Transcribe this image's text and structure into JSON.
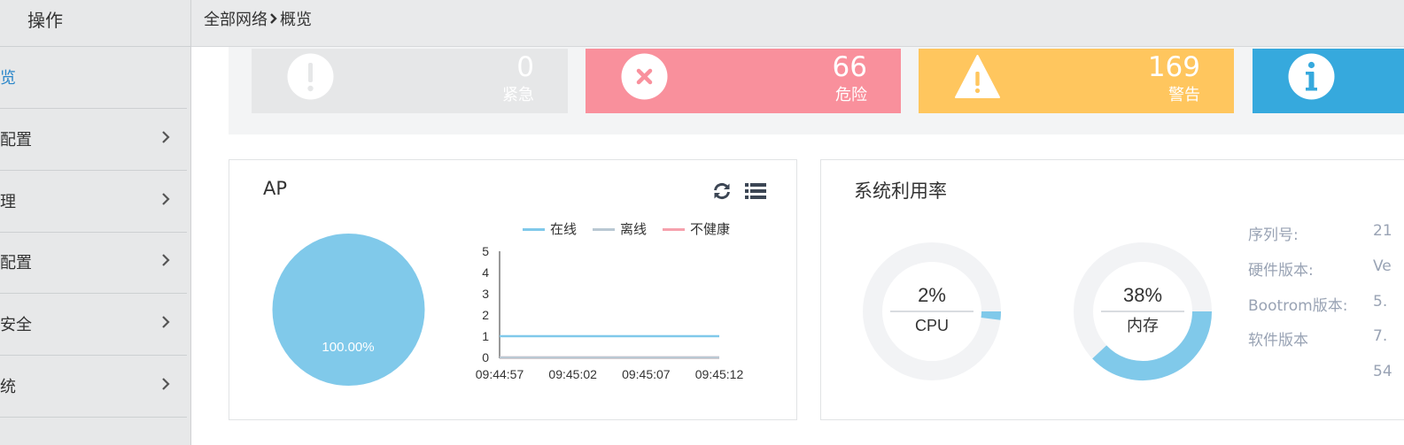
{
  "sidebar": {
    "header": "操作",
    "items": [
      {
        "label": "览",
        "has_chevron": false
      },
      {
        "label": "配置",
        "has_chevron": true
      },
      {
        "label": "理",
        "has_chevron": true
      },
      {
        "label": "配置",
        "has_chevron": true
      },
      {
        "label": "安全",
        "has_chevron": true
      },
      {
        "label": "统",
        "has_chevron": true
      }
    ]
  },
  "breadcrumb": {
    "parent": "全部网络",
    "current": "概览"
  },
  "alarms": [
    {
      "count": "0",
      "label": "紧急",
      "color": "#e6e7e8",
      "icon": "exclamation-circle-icon"
    },
    {
      "count": "66",
      "label": "危险",
      "color": "#f9909c",
      "icon": "x-circle-icon"
    },
    {
      "count": "169",
      "label": "警告",
      "color": "#ffc65e",
      "icon": "warning-triangle-icon"
    },
    {
      "count": "",
      "label": "",
      "color": "#36a9dd",
      "icon": "info-circle-icon"
    }
  ],
  "ap_panel": {
    "title": "AP",
    "refresh_icon": "refresh-icon",
    "list_icon": "list-icon",
    "pie": {
      "label": "100.00%",
      "color": "#80c9ea"
    },
    "legend": [
      {
        "name": "在线",
        "color": "#80c9ea"
      },
      {
        "name": "离线",
        "color": "#b9c8d3"
      },
      {
        "name": "不健康",
        "color": "#f6a1ad"
      }
    ]
  },
  "system_panel": {
    "title": "系统利用率",
    "gauges": [
      {
        "value": "2%",
        "name": "CPU",
        "percent": 2
      },
      {
        "value": "38%",
        "name": "内存",
        "percent": 38
      }
    ],
    "info": [
      {
        "label": "序列号:",
        "value": "21"
      },
      {
        "label": "硬件版本:",
        "value": "Ve"
      },
      {
        "label": "Bootrom版本:",
        "value": "5."
      },
      {
        "label": "软件版本",
        "value": "7."
      },
      {
        "label": "",
        "value": "54"
      }
    ]
  },
  "chart_data": [
    {
      "type": "pie",
      "categories": [
        "在线"
      ],
      "values": [
        100
      ],
      "labels": [
        "100.00%"
      ]
    },
    {
      "type": "line",
      "x": [
        "09:44:57",
        "09:45:02",
        "09:45:07",
        "09:45:12"
      ],
      "series": [
        {
          "name": "在线",
          "values": [
            1,
            1,
            1,
            1
          ]
        },
        {
          "name": "离线",
          "values": [
            0,
            0,
            0,
            0
          ]
        },
        {
          "name": "不健康",
          "values": [
            0,
            0,
            0,
            0
          ]
        }
      ],
      "yticks": [
        "0",
        "1",
        "2",
        "3",
        "4",
        "5"
      ],
      "ylim": [
        0,
        5
      ],
      "legend_position": "top"
    }
  ]
}
